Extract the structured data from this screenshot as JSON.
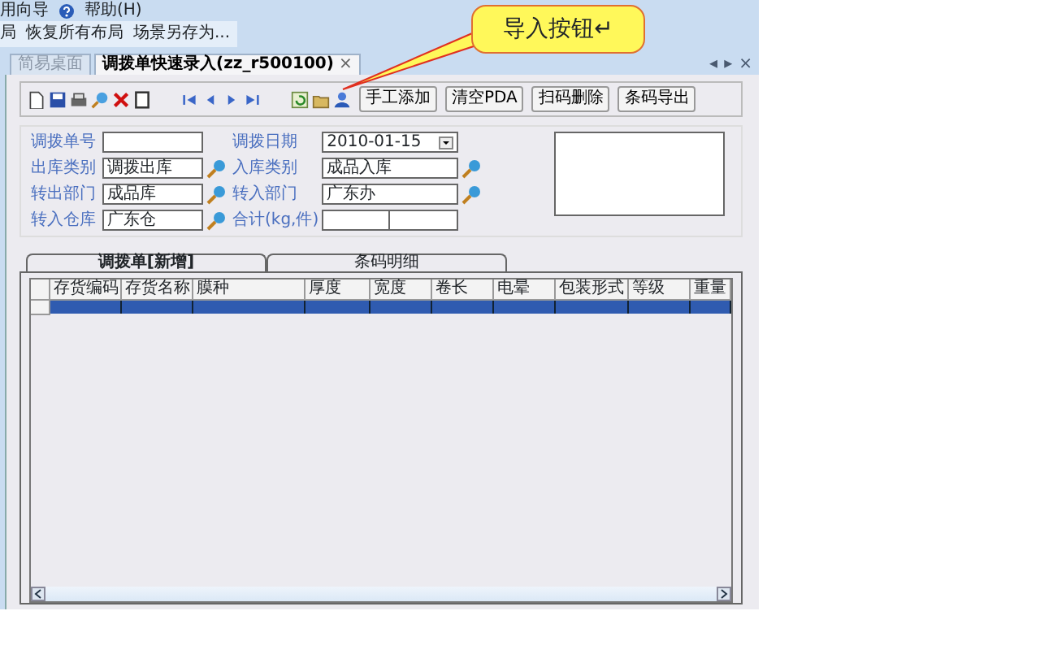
{
  "menu_items": [
    {
      "label": "用向导",
      "kind": "plain"
    },
    {
      "label": "帮助(H)",
      "kind": "help"
    }
  ],
  "layout_bar": [
    "局",
    "恢复所有布局",
    "场景另存为..."
  ],
  "tabs": [
    {
      "label": "简易桌面",
      "selected": false
    },
    {
      "label": "调拨单快速录入(zz_r500100)",
      "selected": true,
      "close": "×"
    }
  ],
  "tab_controls": [
    "◂",
    "▸",
    "×"
  ],
  "toolbar_buttons": [
    "手工添加",
    "清空PDA",
    "扫码删除",
    "条码导出"
  ],
  "form": [
    {
      "label": "调拨单号",
      "kind": "text",
      "lookup": false
    },
    {
      "label": "调拨日期",
      "kind": "date",
      "value": "2010-01-15",
      "lookup": false
    },
    {
      "label": "出库类别",
      "kind": "text",
      "value": "调拨出库",
      "lookup": true
    },
    {
      "label": "入库类别",
      "kind": "text",
      "value": "成品入库",
      "lookup": true
    },
    {
      "label": "转出部门",
      "kind": "text",
      "value": "成品库",
      "lookup": true
    },
    {
      "label": "转入部门",
      "kind": "text",
      "value": "广东办",
      "lookup": true
    },
    {
      "label": "转入仓库",
      "kind": "text",
      "value": "广东仓",
      "lookup": true
    },
    {
      "label": "合计(kg,件)",
      "kind": "split",
      "lookup": false
    }
  ],
  "detail_tabs": [
    {
      "label": "调拨单[新增]",
      "selected": true
    },
    {
      "label": "条码明细",
      "selected": false
    }
  ],
  "table": {
    "columns": [
      "存货编码",
      "存货名称",
      "膜种",
      "厚度",
      "宽度",
      "卷长",
      "电晕",
      "包装形式",
      "等级",
      "重量"
    ],
    "rows": [
      {
        "selected": true
      }
    ]
  },
  "callout": {
    "text": "导入按钮↵"
  }
}
